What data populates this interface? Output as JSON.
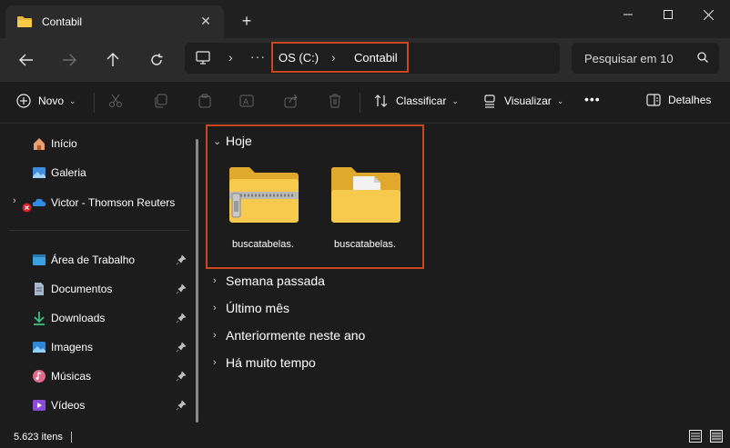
{
  "window": {
    "tab_title": "Contabil",
    "new_tab_label": "+"
  },
  "address": {
    "crumbs": [
      "OS (C:)",
      "Contabil"
    ],
    "overflow": "···",
    "search_placeholder": "Pesquisar em 10"
  },
  "toolbar": {
    "new_label": "Novo",
    "sort_label": "Classificar",
    "view_label": "Visualizar",
    "more_label": "•••",
    "details_label": "Detalhes"
  },
  "sidebar": {
    "items": [
      {
        "label": "Início",
        "icon": "home-icon"
      },
      {
        "label": "Galeria",
        "icon": "gallery-icon"
      },
      {
        "label": "Victor - Thomson Reuters Inc",
        "icon": "onedrive-icon"
      },
      {
        "label": "Área de Trabalho",
        "icon": "desktop-icon"
      },
      {
        "label": "Documentos",
        "icon": "documents-icon"
      },
      {
        "label": "Downloads",
        "icon": "downloads-icon"
      },
      {
        "label": "Imagens",
        "icon": "pictures-icon"
      },
      {
        "label": "Músicas",
        "icon": "music-icon"
      },
      {
        "label": "Vídeos",
        "icon": "videos-icon"
      }
    ]
  },
  "content": {
    "groups": [
      {
        "label": "Hoje",
        "expanded": true
      },
      {
        "label": "Semana passada",
        "expanded": false
      },
      {
        "label": "Último mês",
        "expanded": false
      },
      {
        "label": "Anteriormente neste ano",
        "expanded": false
      },
      {
        "label": "Há muito tempo",
        "expanded": false
      }
    ],
    "files": [
      {
        "name": "buscatabelas.",
        "icon": "zip-folder-icon"
      },
      {
        "name": "buscatabelas.",
        "icon": "folder-icon"
      }
    ]
  },
  "status": {
    "item_count": "5.623 itens"
  },
  "colors": {
    "highlight": "#c8471c",
    "folder": "#f7c948",
    "accent": "#4cc2ff"
  }
}
